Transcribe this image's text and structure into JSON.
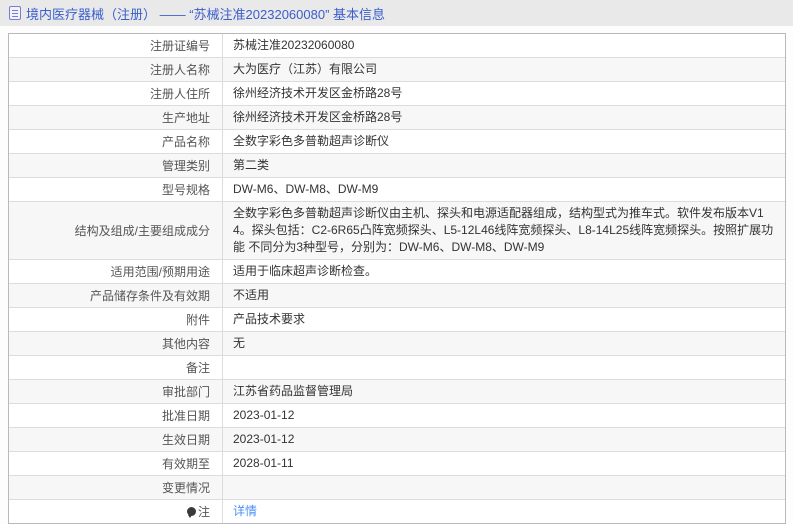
{
  "header": {
    "title": "境内医疗器械（注册） —— “苏械注准20232060080” 基本信息",
    "icon": "document-icon"
  },
  "colors": {
    "title_blue": "#3a5ecc",
    "link_blue": "#4a90f5",
    "strip_gray": "#e9e9e9",
    "alt_row": "#f7f7f7",
    "border": "#dcdcdc"
  },
  "table": {
    "rows": [
      {
        "label": "注册证编号",
        "value": "苏械注准20232060080"
      },
      {
        "label": "注册人名称",
        "value": "大为医疗（江苏）有限公司"
      },
      {
        "label": "注册人住所",
        "value": "徐州经济技术开发区金桥路28号"
      },
      {
        "label": "生产地址",
        "value": "徐州经济技术开发区金桥路28号"
      },
      {
        "label": "产品名称",
        "value": "全数字彩色多普勒超声诊断仪"
      },
      {
        "label": "管理类别",
        "value": "第二类"
      },
      {
        "label": "型号规格",
        "value": "DW-M6、DW-M8、DW-M9"
      },
      {
        "label": "结构及组成/主要组成成分",
        "value": "全数字彩色多普勒超声诊断仪由主机、探头和电源适配器组成，结构型式为推车式。软件发布版本V14。探头包括：C2-6R65凸阵宽频探头、L5-12L46线阵宽频探头、L8-14L25线阵宽频探头。按照扩展功能 不同分为3种型号，分别为：DW-M6、DW-M8、DW-M9"
      },
      {
        "label": "适用范围/预期用途",
        "value": "适用于临床超声诊断检查。"
      },
      {
        "label": "产品储存条件及有效期",
        "value": "不适用"
      },
      {
        "label": "附件",
        "value": "产品技术要求"
      },
      {
        "label": "其他内容",
        "value": "无"
      },
      {
        "label": "备注",
        "value": ""
      },
      {
        "label": "审批部门",
        "value": "江苏省药品监督管理局"
      },
      {
        "label": "批准日期",
        "value": "2023-01-12"
      },
      {
        "label": "生效日期",
        "value": "2023-01-12"
      },
      {
        "label": "有效期至",
        "value": "2028-01-11"
      },
      {
        "label": "变更情况",
        "value": ""
      },
      {
        "label": "注",
        "label_icon": "note-icon",
        "value": "详情",
        "value_type": "link"
      }
    ]
  }
}
